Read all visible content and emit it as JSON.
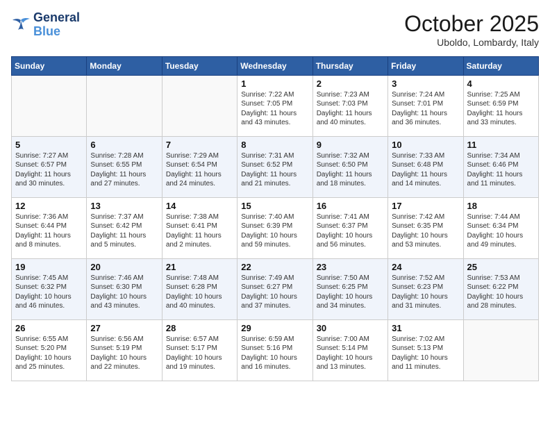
{
  "logo": {
    "line1": "General",
    "line2": "Blue"
  },
  "title": "October 2025",
  "location": "Uboldo, Lombardy, Italy",
  "weekdays": [
    "Sunday",
    "Monday",
    "Tuesday",
    "Wednesday",
    "Thursday",
    "Friday",
    "Saturday"
  ],
  "weeks": [
    [
      {
        "day": "",
        "text": ""
      },
      {
        "day": "",
        "text": ""
      },
      {
        "day": "",
        "text": ""
      },
      {
        "day": "1",
        "text": "Sunrise: 7:22 AM\nSunset: 7:05 PM\nDaylight: 11 hours and 43 minutes."
      },
      {
        "day": "2",
        "text": "Sunrise: 7:23 AM\nSunset: 7:03 PM\nDaylight: 11 hours and 40 minutes."
      },
      {
        "day": "3",
        "text": "Sunrise: 7:24 AM\nSunset: 7:01 PM\nDaylight: 11 hours and 36 minutes."
      },
      {
        "day": "4",
        "text": "Sunrise: 7:25 AM\nSunset: 6:59 PM\nDaylight: 11 hours and 33 minutes."
      }
    ],
    [
      {
        "day": "5",
        "text": "Sunrise: 7:27 AM\nSunset: 6:57 PM\nDaylight: 11 hours and 30 minutes."
      },
      {
        "day": "6",
        "text": "Sunrise: 7:28 AM\nSunset: 6:55 PM\nDaylight: 11 hours and 27 minutes."
      },
      {
        "day": "7",
        "text": "Sunrise: 7:29 AM\nSunset: 6:54 PM\nDaylight: 11 hours and 24 minutes."
      },
      {
        "day": "8",
        "text": "Sunrise: 7:31 AM\nSunset: 6:52 PM\nDaylight: 11 hours and 21 minutes."
      },
      {
        "day": "9",
        "text": "Sunrise: 7:32 AM\nSunset: 6:50 PM\nDaylight: 11 hours and 18 minutes."
      },
      {
        "day": "10",
        "text": "Sunrise: 7:33 AM\nSunset: 6:48 PM\nDaylight: 11 hours and 14 minutes."
      },
      {
        "day": "11",
        "text": "Sunrise: 7:34 AM\nSunset: 6:46 PM\nDaylight: 11 hours and 11 minutes."
      }
    ],
    [
      {
        "day": "12",
        "text": "Sunrise: 7:36 AM\nSunset: 6:44 PM\nDaylight: 11 hours and 8 minutes."
      },
      {
        "day": "13",
        "text": "Sunrise: 7:37 AM\nSunset: 6:42 PM\nDaylight: 11 hours and 5 minutes."
      },
      {
        "day": "14",
        "text": "Sunrise: 7:38 AM\nSunset: 6:41 PM\nDaylight: 11 hours and 2 minutes."
      },
      {
        "day": "15",
        "text": "Sunrise: 7:40 AM\nSunset: 6:39 PM\nDaylight: 10 hours and 59 minutes."
      },
      {
        "day": "16",
        "text": "Sunrise: 7:41 AM\nSunset: 6:37 PM\nDaylight: 10 hours and 56 minutes."
      },
      {
        "day": "17",
        "text": "Sunrise: 7:42 AM\nSunset: 6:35 PM\nDaylight: 10 hours and 53 minutes."
      },
      {
        "day": "18",
        "text": "Sunrise: 7:44 AM\nSunset: 6:34 PM\nDaylight: 10 hours and 49 minutes."
      }
    ],
    [
      {
        "day": "19",
        "text": "Sunrise: 7:45 AM\nSunset: 6:32 PM\nDaylight: 10 hours and 46 minutes."
      },
      {
        "day": "20",
        "text": "Sunrise: 7:46 AM\nSunset: 6:30 PM\nDaylight: 10 hours and 43 minutes."
      },
      {
        "day": "21",
        "text": "Sunrise: 7:48 AM\nSunset: 6:28 PM\nDaylight: 10 hours and 40 minutes."
      },
      {
        "day": "22",
        "text": "Sunrise: 7:49 AM\nSunset: 6:27 PM\nDaylight: 10 hours and 37 minutes."
      },
      {
        "day": "23",
        "text": "Sunrise: 7:50 AM\nSunset: 6:25 PM\nDaylight: 10 hours and 34 minutes."
      },
      {
        "day": "24",
        "text": "Sunrise: 7:52 AM\nSunset: 6:23 PM\nDaylight: 10 hours and 31 minutes."
      },
      {
        "day": "25",
        "text": "Sunrise: 7:53 AM\nSunset: 6:22 PM\nDaylight: 10 hours and 28 minutes."
      }
    ],
    [
      {
        "day": "26",
        "text": "Sunrise: 6:55 AM\nSunset: 5:20 PM\nDaylight: 10 hours and 25 minutes."
      },
      {
        "day": "27",
        "text": "Sunrise: 6:56 AM\nSunset: 5:19 PM\nDaylight: 10 hours and 22 minutes."
      },
      {
        "day": "28",
        "text": "Sunrise: 6:57 AM\nSunset: 5:17 PM\nDaylight: 10 hours and 19 minutes."
      },
      {
        "day": "29",
        "text": "Sunrise: 6:59 AM\nSunset: 5:16 PM\nDaylight: 10 hours and 16 minutes."
      },
      {
        "day": "30",
        "text": "Sunrise: 7:00 AM\nSunset: 5:14 PM\nDaylight: 10 hours and 13 minutes."
      },
      {
        "day": "31",
        "text": "Sunrise: 7:02 AM\nSunset: 5:13 PM\nDaylight: 10 hours and 11 minutes."
      },
      {
        "day": "",
        "text": ""
      }
    ]
  ]
}
